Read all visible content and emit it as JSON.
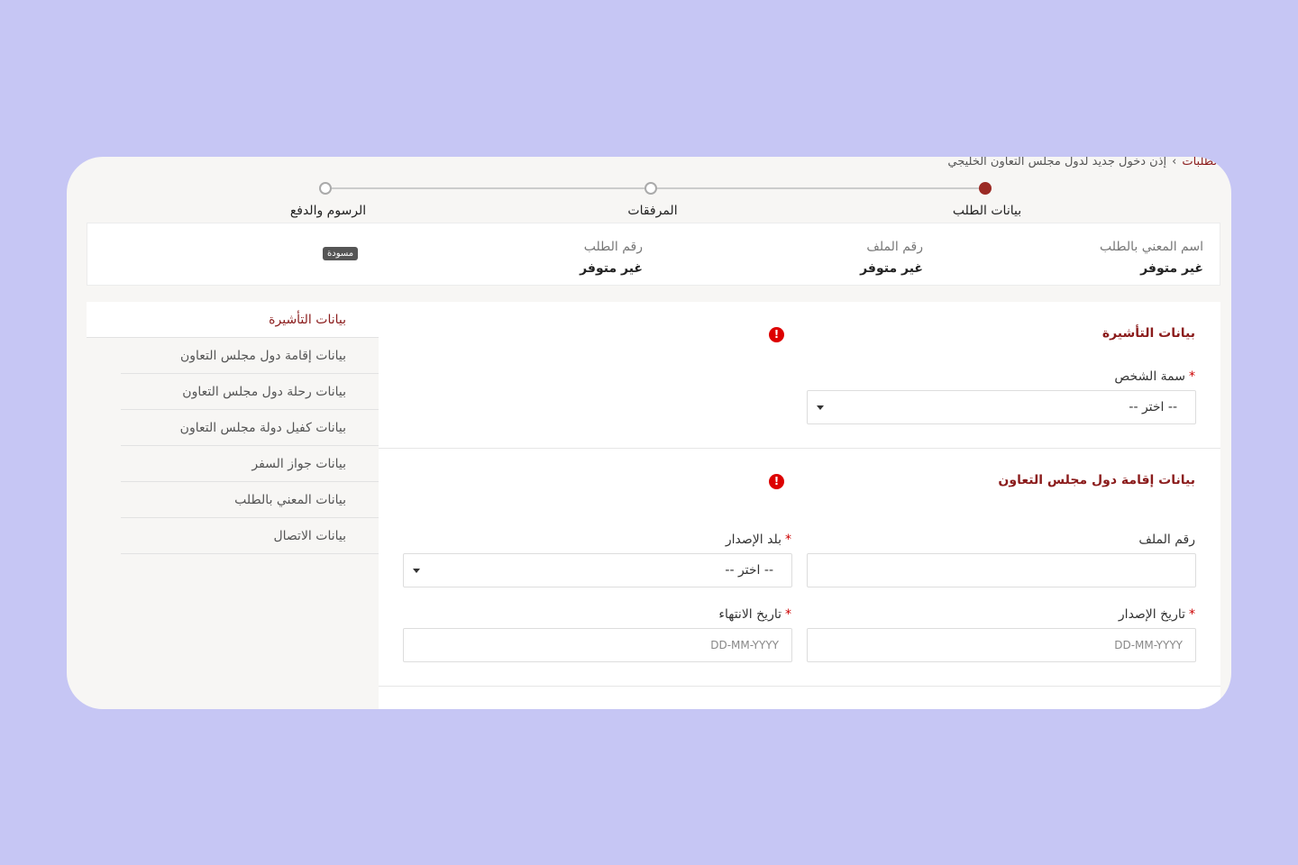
{
  "breadcrumb": {
    "link": "الطلبات",
    "separator": "›",
    "current": "إذن دخول جديد لدول مجلس التعاون الخليجي"
  },
  "stepper": {
    "steps": [
      {
        "label": "بيانات الطلب",
        "active": true
      },
      {
        "label": "المرفقات",
        "active": false
      },
      {
        "label": "الرسوم والدفع",
        "active": false
      }
    ]
  },
  "summary": {
    "applicant_label": "اسم المعني بالطلب",
    "applicant_value": "غير متوفر",
    "file_label": "رقم الملف",
    "file_value": "غير متوفر",
    "request_label": "رقم الطلب",
    "request_value": "غير متوفر",
    "status_badge": "مسودة"
  },
  "sidebar": {
    "items": [
      {
        "label": "بيانات التأشيرة",
        "active": true
      },
      {
        "label": "بيانات إقامة دول مجلس التعاون",
        "active": false
      },
      {
        "label": "بيانات رحلة دول مجلس التعاون",
        "active": false
      },
      {
        "label": "بيانات كفيل دولة مجلس التعاون",
        "active": false
      },
      {
        "label": "بيانات جواز السفر",
        "active": false
      },
      {
        "label": "بيانات المعني بالطلب",
        "active": false
      },
      {
        "label": "بيانات الاتصال",
        "active": false
      }
    ]
  },
  "visa_section": {
    "title": "بيانات التأشيرة",
    "error_icon": "!",
    "person_attr_label": "سمة الشخص",
    "person_attr_value": "-- اختر --"
  },
  "residence_section": {
    "title": "بيانات إقامة دول مجلس التعاون",
    "error_icon": "!",
    "file_number_label": "رقم الملف",
    "country_label": "بلد الإصدار",
    "country_value": "-- اختر --",
    "issue_date_label": "تاريخ الإصدار",
    "issue_date_placeholder": "DD-MM-YYYY",
    "expiry_date_label": "تاريخ الانتهاء",
    "expiry_date_placeholder": "DD-MM-YYYY"
  },
  "required_marker": "*",
  "colors": {
    "accent": "#8b1c1c",
    "active_step": "#9b2a24",
    "error": "#dd0000",
    "background": "#c6c6f4"
  }
}
